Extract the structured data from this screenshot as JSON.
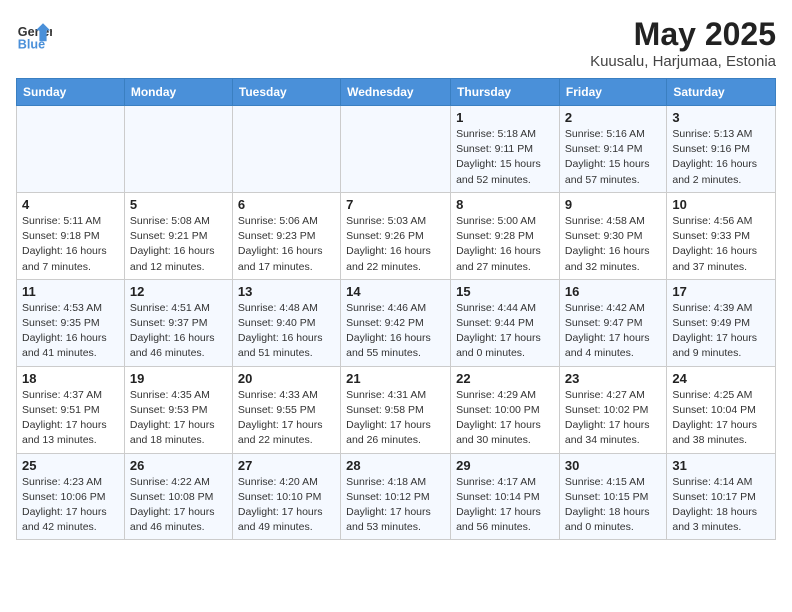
{
  "header": {
    "logo_line1": "General",
    "logo_line2": "Blue",
    "month_title": "May 2025",
    "subtitle": "Kuusalu, Harjumaa, Estonia"
  },
  "weekdays": [
    "Sunday",
    "Monday",
    "Tuesday",
    "Wednesday",
    "Thursday",
    "Friday",
    "Saturday"
  ],
  "weeks": [
    [
      {
        "day": "",
        "info": ""
      },
      {
        "day": "",
        "info": ""
      },
      {
        "day": "",
        "info": ""
      },
      {
        "day": "",
        "info": ""
      },
      {
        "day": "1",
        "info": "Sunrise: 5:18 AM\nSunset: 9:11 PM\nDaylight: 15 hours\nand 52 minutes."
      },
      {
        "day": "2",
        "info": "Sunrise: 5:16 AM\nSunset: 9:14 PM\nDaylight: 15 hours\nand 57 minutes."
      },
      {
        "day": "3",
        "info": "Sunrise: 5:13 AM\nSunset: 9:16 PM\nDaylight: 16 hours\nand 2 minutes."
      }
    ],
    [
      {
        "day": "4",
        "info": "Sunrise: 5:11 AM\nSunset: 9:18 PM\nDaylight: 16 hours\nand 7 minutes."
      },
      {
        "day": "5",
        "info": "Sunrise: 5:08 AM\nSunset: 9:21 PM\nDaylight: 16 hours\nand 12 minutes."
      },
      {
        "day": "6",
        "info": "Sunrise: 5:06 AM\nSunset: 9:23 PM\nDaylight: 16 hours\nand 17 minutes."
      },
      {
        "day": "7",
        "info": "Sunrise: 5:03 AM\nSunset: 9:26 PM\nDaylight: 16 hours\nand 22 minutes."
      },
      {
        "day": "8",
        "info": "Sunrise: 5:00 AM\nSunset: 9:28 PM\nDaylight: 16 hours\nand 27 minutes."
      },
      {
        "day": "9",
        "info": "Sunrise: 4:58 AM\nSunset: 9:30 PM\nDaylight: 16 hours\nand 32 minutes."
      },
      {
        "day": "10",
        "info": "Sunrise: 4:56 AM\nSunset: 9:33 PM\nDaylight: 16 hours\nand 37 minutes."
      }
    ],
    [
      {
        "day": "11",
        "info": "Sunrise: 4:53 AM\nSunset: 9:35 PM\nDaylight: 16 hours\nand 41 minutes."
      },
      {
        "day": "12",
        "info": "Sunrise: 4:51 AM\nSunset: 9:37 PM\nDaylight: 16 hours\nand 46 minutes."
      },
      {
        "day": "13",
        "info": "Sunrise: 4:48 AM\nSunset: 9:40 PM\nDaylight: 16 hours\nand 51 minutes."
      },
      {
        "day": "14",
        "info": "Sunrise: 4:46 AM\nSunset: 9:42 PM\nDaylight: 16 hours\nand 55 minutes."
      },
      {
        "day": "15",
        "info": "Sunrise: 4:44 AM\nSunset: 9:44 PM\nDaylight: 17 hours\nand 0 minutes."
      },
      {
        "day": "16",
        "info": "Sunrise: 4:42 AM\nSunset: 9:47 PM\nDaylight: 17 hours\nand 4 minutes."
      },
      {
        "day": "17",
        "info": "Sunrise: 4:39 AM\nSunset: 9:49 PM\nDaylight: 17 hours\nand 9 minutes."
      }
    ],
    [
      {
        "day": "18",
        "info": "Sunrise: 4:37 AM\nSunset: 9:51 PM\nDaylight: 17 hours\nand 13 minutes."
      },
      {
        "day": "19",
        "info": "Sunrise: 4:35 AM\nSunset: 9:53 PM\nDaylight: 17 hours\nand 18 minutes."
      },
      {
        "day": "20",
        "info": "Sunrise: 4:33 AM\nSunset: 9:55 PM\nDaylight: 17 hours\nand 22 minutes."
      },
      {
        "day": "21",
        "info": "Sunrise: 4:31 AM\nSunset: 9:58 PM\nDaylight: 17 hours\nand 26 minutes."
      },
      {
        "day": "22",
        "info": "Sunrise: 4:29 AM\nSunset: 10:00 PM\nDaylight: 17 hours\nand 30 minutes."
      },
      {
        "day": "23",
        "info": "Sunrise: 4:27 AM\nSunset: 10:02 PM\nDaylight: 17 hours\nand 34 minutes."
      },
      {
        "day": "24",
        "info": "Sunrise: 4:25 AM\nSunset: 10:04 PM\nDaylight: 17 hours\nand 38 minutes."
      }
    ],
    [
      {
        "day": "25",
        "info": "Sunrise: 4:23 AM\nSunset: 10:06 PM\nDaylight: 17 hours\nand 42 minutes."
      },
      {
        "day": "26",
        "info": "Sunrise: 4:22 AM\nSunset: 10:08 PM\nDaylight: 17 hours\nand 46 minutes."
      },
      {
        "day": "27",
        "info": "Sunrise: 4:20 AM\nSunset: 10:10 PM\nDaylight: 17 hours\nand 49 minutes."
      },
      {
        "day": "28",
        "info": "Sunrise: 4:18 AM\nSunset: 10:12 PM\nDaylight: 17 hours\nand 53 minutes."
      },
      {
        "day": "29",
        "info": "Sunrise: 4:17 AM\nSunset: 10:14 PM\nDaylight: 17 hours\nand 56 minutes."
      },
      {
        "day": "30",
        "info": "Sunrise: 4:15 AM\nSunset: 10:15 PM\nDaylight: 18 hours\nand 0 minutes."
      },
      {
        "day": "31",
        "info": "Sunrise: 4:14 AM\nSunset: 10:17 PM\nDaylight: 18 hours\nand 3 minutes."
      }
    ]
  ]
}
